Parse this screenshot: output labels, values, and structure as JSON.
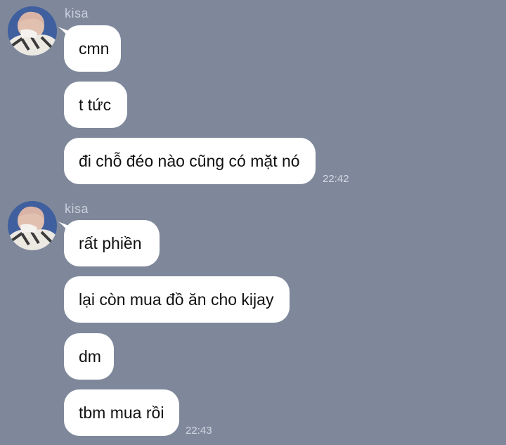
{
  "groups": [
    {
      "sender": "kisa",
      "messages": [
        "cmn",
        "t tức",
        "đi chỗ đéo nào cũng có mặt nó"
      ],
      "time": "22:42"
    },
    {
      "sender": "kisa",
      "messages": [
        "rất phiền",
        "lại còn mua đồ ăn cho kijay",
        "dm",
        "tbm mua rồi"
      ],
      "time": "22:43"
    }
  ],
  "colors": {
    "background": "#7f889b",
    "bubble": "#ffffff",
    "text": "#111111"
  }
}
